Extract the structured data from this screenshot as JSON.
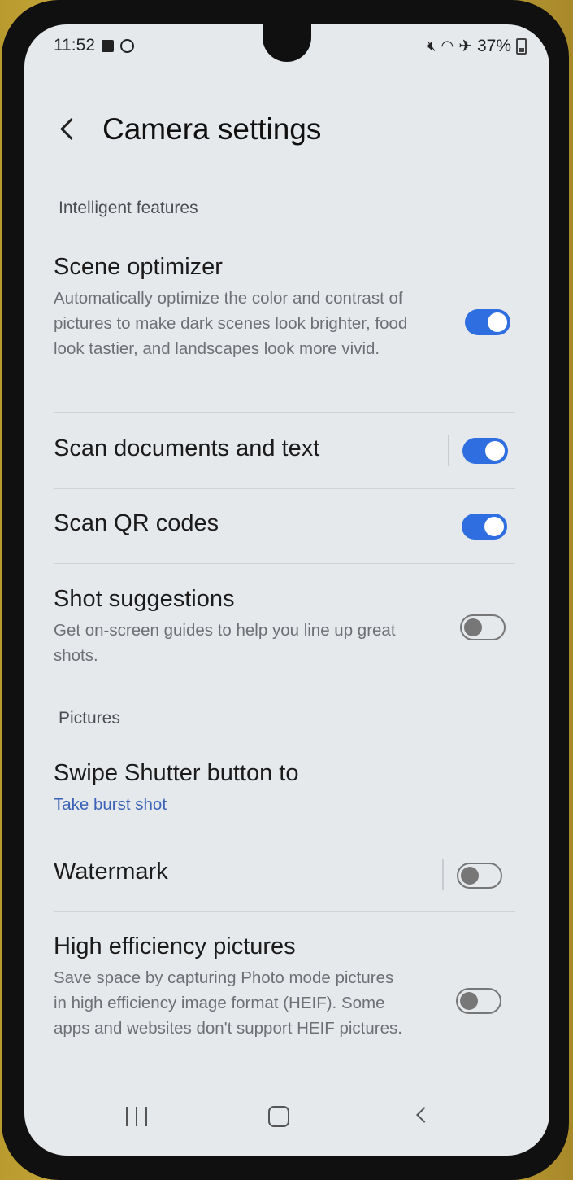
{
  "status_bar": {
    "time": "11:52",
    "battery": "37%",
    "icons": [
      "notification-square-icon",
      "sync-circle-icon",
      "mute-icon",
      "wifi-icon",
      "airplane-icon",
      "battery-icon"
    ]
  },
  "header": {
    "title": "Camera settings"
  },
  "sections": [
    {
      "label": "Intelligent features",
      "items": [
        {
          "title": "Scene optimizer",
          "description": "Automatically optimize the color and contrast of pictures to make dark scenes look brighter, food look tastier, and landscapes look more vivid.",
          "toggle": "on"
        },
        {
          "title": "Scan documents and text",
          "toggle": "on"
        },
        {
          "title": "Scan QR codes",
          "toggle": "on"
        },
        {
          "title": "Shot suggestions",
          "description": "Get on-screen guides to help you line up great shots.",
          "toggle": "off"
        }
      ]
    },
    {
      "label": "Pictures",
      "items": [
        {
          "title": "Swipe Shutter button to",
          "subtitle": "Take burst shot"
        },
        {
          "title": "Watermark",
          "toggle": "off"
        },
        {
          "title": "High efficiency pictures",
          "description": "Save space by capturing Photo mode pictures in high efficiency image format (HEIF). Some apps and websites don't support HEIF pictures.",
          "toggle": "off"
        }
      ]
    }
  ],
  "colors": {
    "accent": "#2e6ee0",
    "link": "#3a62b8",
    "background": "#e6e9ec"
  }
}
